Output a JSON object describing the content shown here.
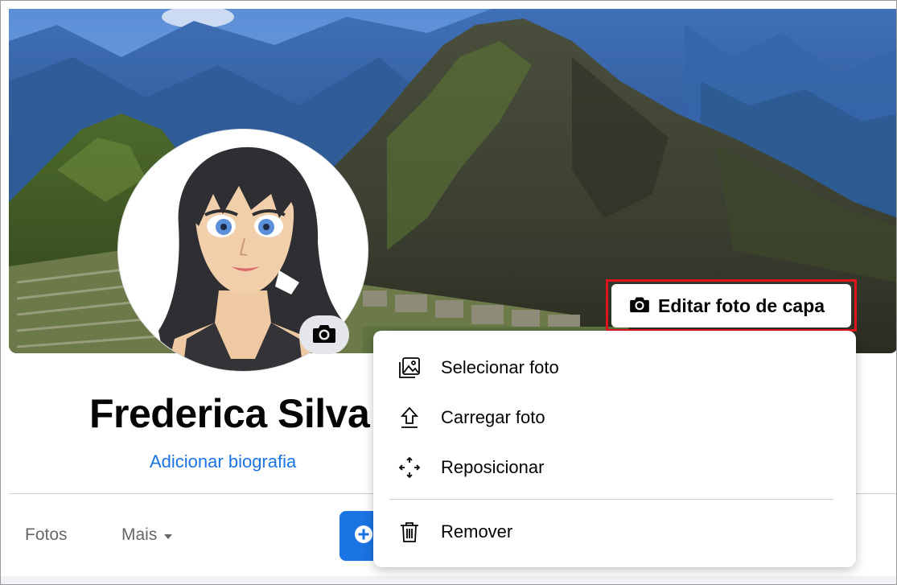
{
  "profile": {
    "name": "Frederica Silva",
    "bio_link": "Adicionar biografia"
  },
  "cover": {
    "edit_button_label": "Editar foto de capa",
    "highlight_color": "#e0141c"
  },
  "cover_menu": {
    "items": [
      {
        "label": "Selecionar foto",
        "icon": "photo-select-icon"
      },
      {
        "label": "Carregar foto",
        "icon": "upload-icon"
      },
      {
        "label": "Reposicionar",
        "icon": "move-arrows-icon"
      },
      {
        "label": "Remover",
        "icon": "trash-icon"
      }
    ]
  },
  "tabs": {
    "fotos": "Fotos",
    "mais": "Mais"
  },
  "colors": {
    "accent": "#1b74e4",
    "text": "#050505",
    "secondary_text": "#65676b"
  }
}
